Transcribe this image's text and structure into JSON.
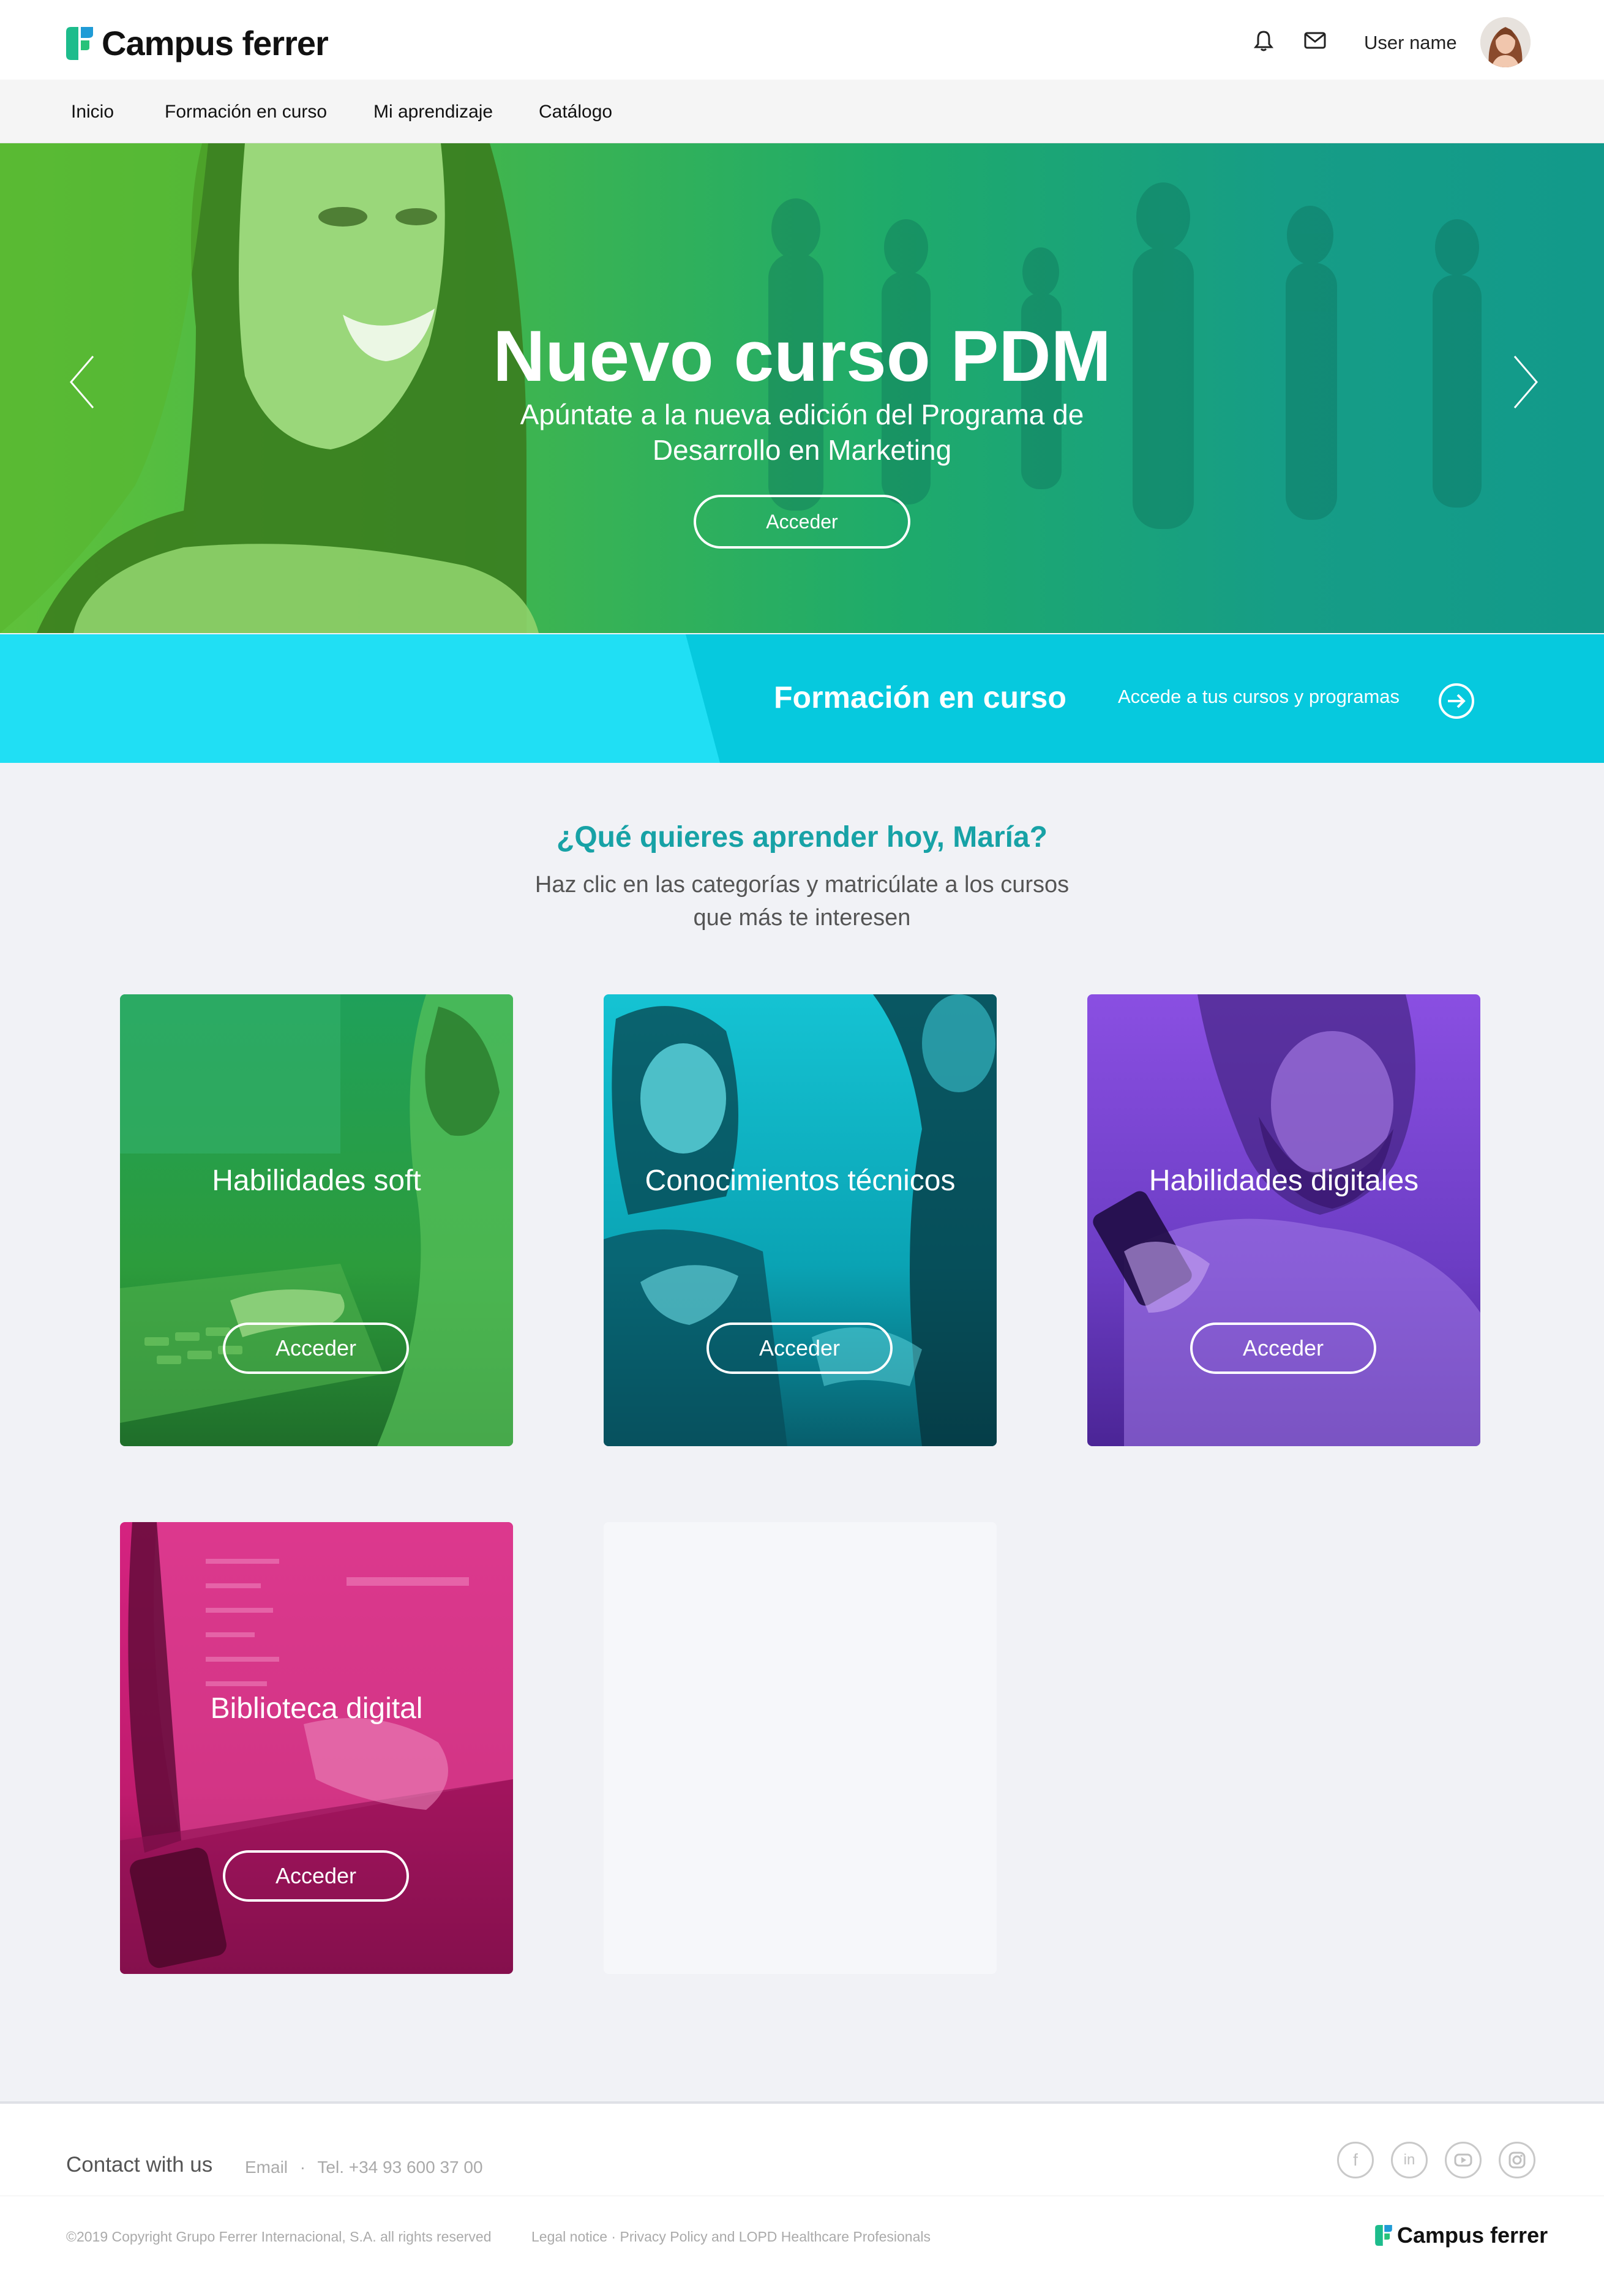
{
  "header": {
    "logo_text": "Campus ferrer",
    "username": "User name",
    "icons": [
      "bell-icon",
      "mail-icon"
    ]
  },
  "nav": {
    "items": [
      {
        "label": "Inicio"
      },
      {
        "label": "Formación en curso"
      },
      {
        "label": "Mi aprendizaje"
      },
      {
        "label": "Catálogo"
      }
    ]
  },
  "hero": {
    "title": "Nuevo curso PDM",
    "subtitle": "Apúntate a la nueva edición del Programa de Desarrollo en Marketing",
    "button_label": "Acceder"
  },
  "banner": {
    "title": "Formación en curso",
    "link_text": "Accede a tus cursos y programas"
  },
  "intro": {
    "title": "¿Qué quieres aprender hoy, María?",
    "subtitle": "Haz clic en las categorías y matricúlate a los cursos que más te interesen"
  },
  "categories": [
    {
      "title": "Habilidades soft",
      "button": "Acceder",
      "color": "#2fae44"
    },
    {
      "title": "Conocimientos técnicos",
      "button": "Acceder",
      "color": "#10b8c8"
    },
    {
      "title": "Habilidades digitales",
      "button": "Acceder",
      "color": "#7040c8"
    },
    {
      "title": "Biblioteca digital",
      "button": "Acceder",
      "color": "#c81a78"
    }
  ],
  "footer": {
    "contact_label": "Contact with us",
    "email_label": "Email",
    "separator": "·",
    "phone": "Tel. +34 93 600 37 00",
    "social_icons": [
      "facebook-icon",
      "linkedin-icon",
      "youtube-icon",
      "instagram-icon"
    ],
    "copyright": "©2019 Copyright Grupo Ferrer Internacional, S.A. all rights reserved",
    "legal": "Legal notice · Privacy Policy and LOPD Healthcare Profesionals",
    "logo_text": "Campus ferrer"
  }
}
